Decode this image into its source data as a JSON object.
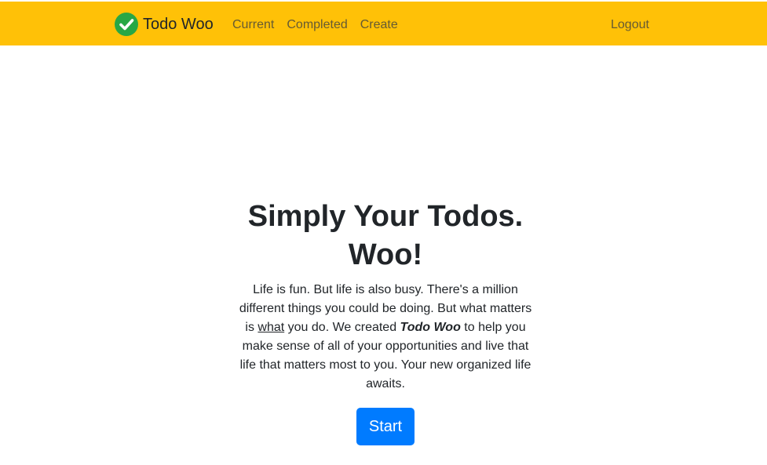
{
  "navbar": {
    "brand": "Todo Woo",
    "links": [
      "Current",
      "Completed",
      "Create"
    ],
    "logout": "Logout",
    "bg_color": "#ffc107",
    "logo_color": "#28a745",
    "logo_icon": "check-circle-icon"
  },
  "hero": {
    "title_line1": "Simply Your Todos.",
    "title_line2": "Woo!",
    "text_part1": "Life is fun. But life is also busy. There's a million different things you could be doing. But what matters is ",
    "text_underline": "what",
    "text_part2": " you do. We created ",
    "text_brand": "Todo Woo",
    "text_part3": " to help you make sense of all of your opportunities and live that life that matters most to you. Your new organized life awaits.",
    "start_button": "Start",
    "button_color": "#007bff"
  }
}
